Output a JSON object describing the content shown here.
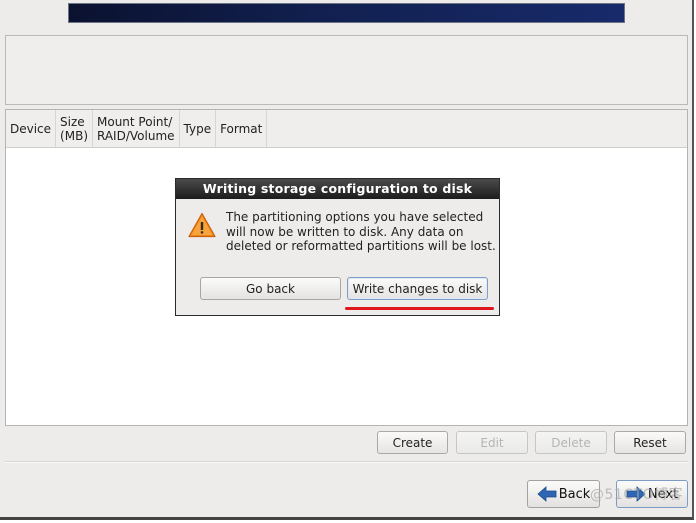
{
  "partition_table": {
    "columns": [
      "Device",
      "Size\n(MB)",
      "Mount Point/\nRAID/Volume",
      "Type",
      "Format"
    ],
    "rows": []
  },
  "actions": {
    "create": "Create",
    "edit": "Edit",
    "delete": "Delete",
    "reset": "Reset"
  },
  "navigation": {
    "back": "Back",
    "next": "Next"
  },
  "dialog": {
    "title": "Writing storage configuration to disk",
    "icon": "warning-icon",
    "message": "The partitioning options you have selected will now be written to disk.  Any data on deleted or reformatted partitions will be lost.",
    "go_back": "Go back",
    "write_changes": "Write changes to disk"
  },
  "watermark": "@51CTO博客",
  "colors": {
    "banner_start": "#0b1230",
    "banner_end": "#182a6b",
    "warning": "#f08a1c",
    "annotation_underline": "#e0161e",
    "nav_arrow": "#2f66b3"
  }
}
